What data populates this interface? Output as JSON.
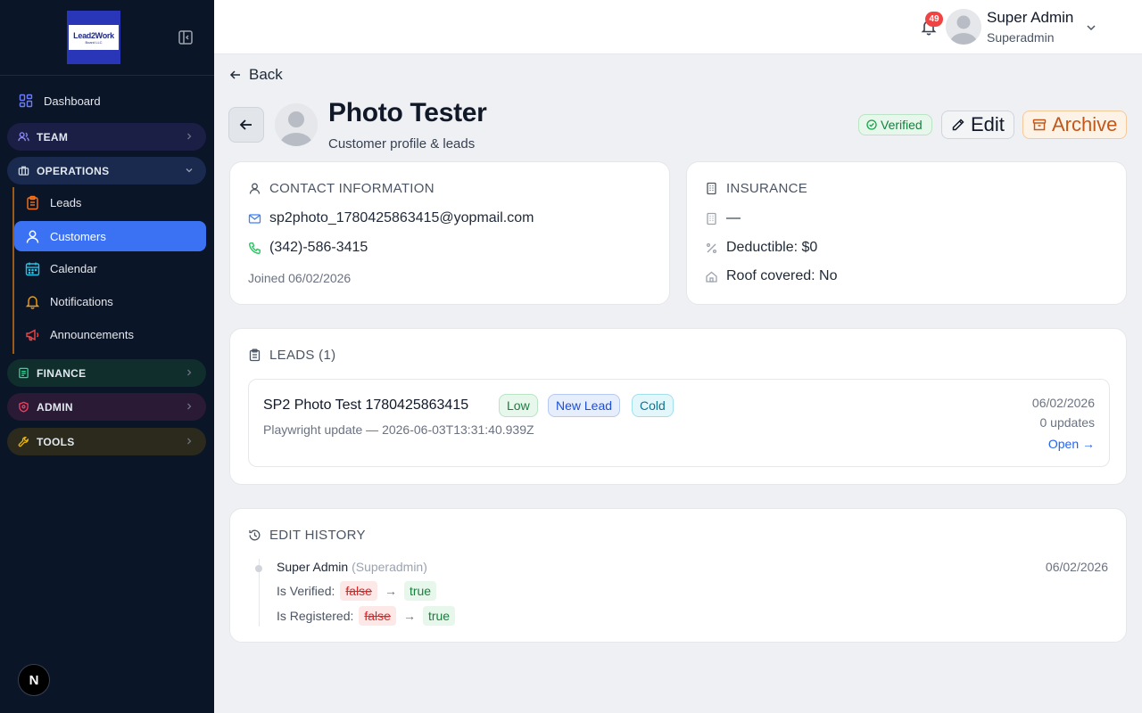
{
  "sidebar": {
    "logo": {
      "text": "Lead2Work",
      "sub": "Board LLC"
    },
    "dashboard": "Dashboard",
    "groups": {
      "team": "TEAM",
      "operations": "OPERATIONS",
      "finance": "FINANCE",
      "admin": "ADMIN",
      "tools": "TOOLS"
    },
    "operations_items": {
      "leads": "Leads",
      "customers": "Customers",
      "calendar": "Calendar",
      "notifications": "Notifications",
      "announcements": "Announcements"
    },
    "footer_badge": "N"
  },
  "header": {
    "notification_count": "49",
    "user_name": "Super Admin",
    "user_role": "Superadmin"
  },
  "page": {
    "back_label": "Back",
    "title": "Photo Tester",
    "subtitle": "Customer profile & leads",
    "verified_label": "Verified",
    "edit_label": "Edit",
    "archive_label": "Archive"
  },
  "contact": {
    "title": "CONTACT INFORMATION",
    "email": "sp2photo_1780425863415@yopmail.com",
    "phone": "(342)-586-3415",
    "joined": "Joined 06/02/2026"
  },
  "insurance": {
    "title": "INSURANCE",
    "company": "—",
    "deductible": "Deductible: $0",
    "roof_covered": "Roof covered: No"
  },
  "leads": {
    "title": "LEADS (1)",
    "items": [
      {
        "name": "SP2 Photo Test 1780425863415",
        "tags": [
          "Low",
          "New Lead",
          "Cold"
        ],
        "description": "Playwright update — 2026-06-03T13:31:40.939Z",
        "date": "06/02/2026",
        "updates": "0 updates",
        "open_label": "Open →"
      }
    ]
  },
  "history": {
    "title": "EDIT HISTORY",
    "entries": [
      {
        "author": "Super Admin",
        "role": "(Superadmin)",
        "date": "06/02/2026",
        "changes": [
          {
            "field": "Is Verified:",
            "old": "false",
            "new": "true"
          },
          {
            "field": "Is Registered:",
            "old": "false",
            "new": "true"
          }
        ]
      }
    ],
    "arrow": "→"
  },
  "colors": {
    "sidebar_bg": "#0b1528",
    "active_item": "#3b71f3",
    "verified": "#15803d",
    "archive": "#c2571a",
    "link": "#2563eb"
  }
}
